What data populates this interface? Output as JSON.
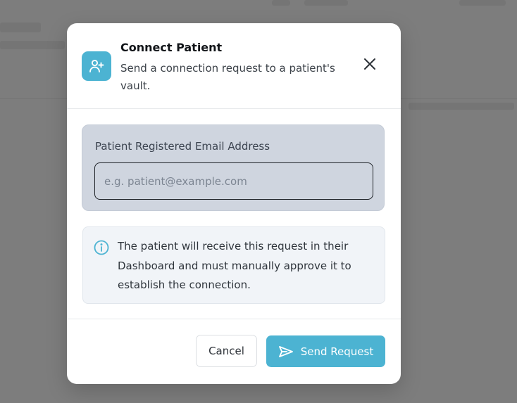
{
  "dialog": {
    "title": "Connect Patient",
    "subtitle": "Send a connection request to a patient's vault.",
    "header_icon": "user-plus-icon",
    "close_icon": "close-icon"
  },
  "email": {
    "label": "Patient Registered Email Address",
    "placeholder": "e.g. patient@example.com",
    "value": ""
  },
  "info": {
    "icon": "info-icon",
    "text": "The patient will receive this request in their Dashboard and must manually approve it to establish the connection."
  },
  "actions": {
    "cancel_label": "Cancel",
    "send_label": "Send Request",
    "send_icon": "send-icon"
  },
  "colors": {
    "accent": "#4cb3d2",
    "backdrop": "#7d7d7d",
    "panel": "#cfd5df",
    "info_bg": "#f1f4f8"
  }
}
